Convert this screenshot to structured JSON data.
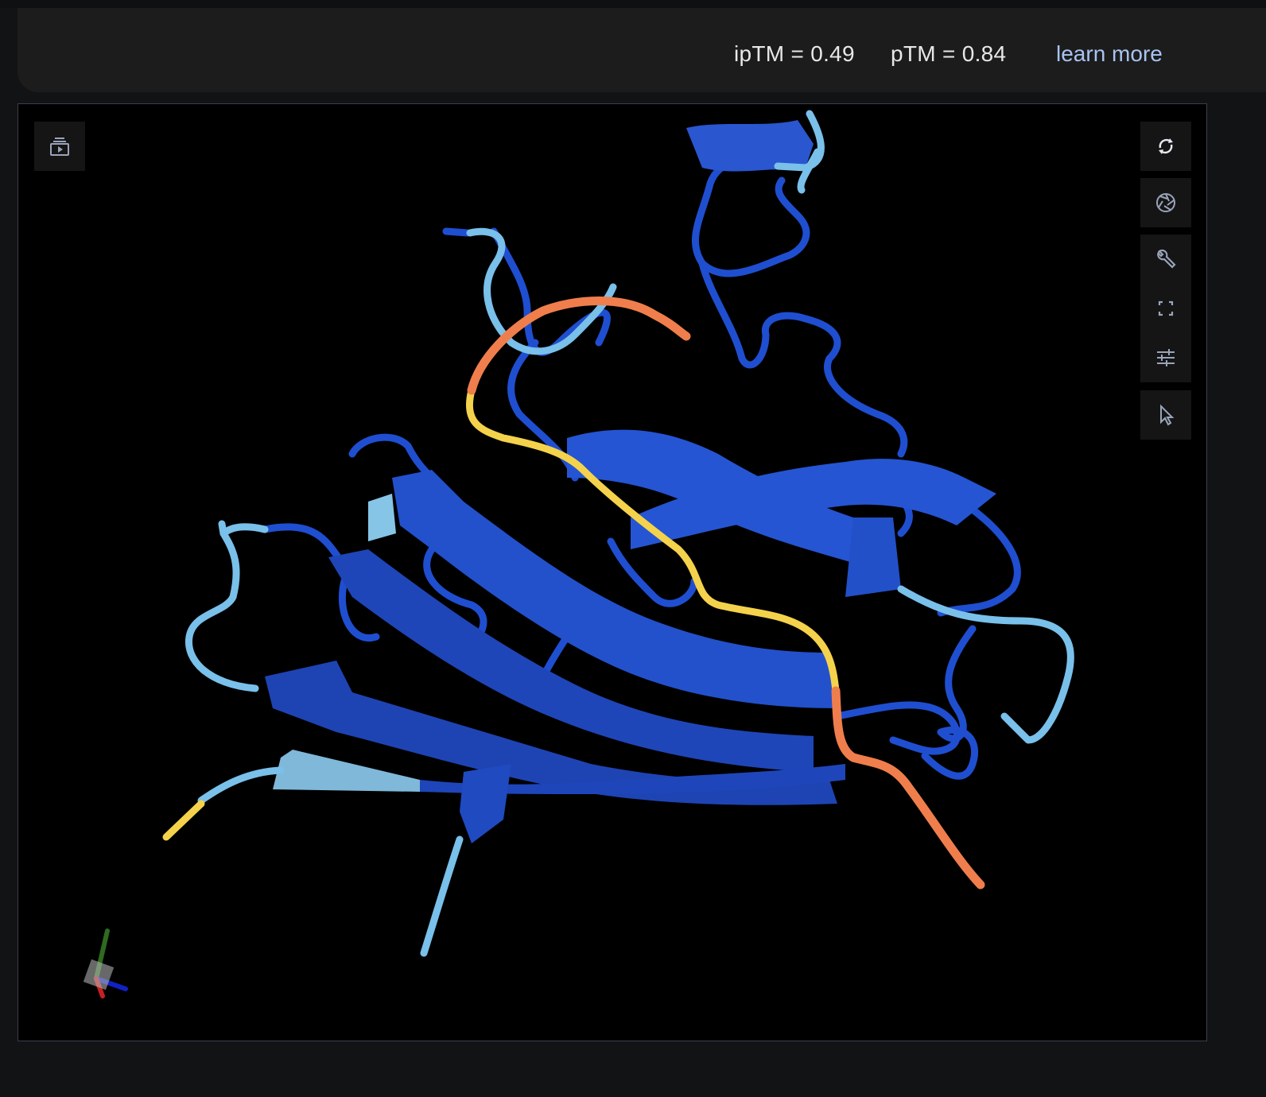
{
  "header": {
    "iptm": "ipTM = 0.49",
    "ptm": "pTM = 0.84",
    "learn_more": "learn more"
  },
  "viewer": {
    "left_toolbar": [
      {
        "icon": "animation-play-icon"
      }
    ],
    "right_toolbar": [
      {
        "icon": "rotate-icon"
      },
      {
        "icon": "camera-shutter-icon"
      },
      {
        "icon": "wrench-icon"
      },
      {
        "icon": "fullscreen-icon"
      },
      {
        "icon": "sliders-icon"
      },
      {
        "icon": "cursor-icon"
      }
    ],
    "confidence_colors": {
      "very_high": "#1f4fd0",
      "high": "#79c0ea",
      "low": "#f5d24b",
      "very_low": "#f07e4c"
    }
  }
}
